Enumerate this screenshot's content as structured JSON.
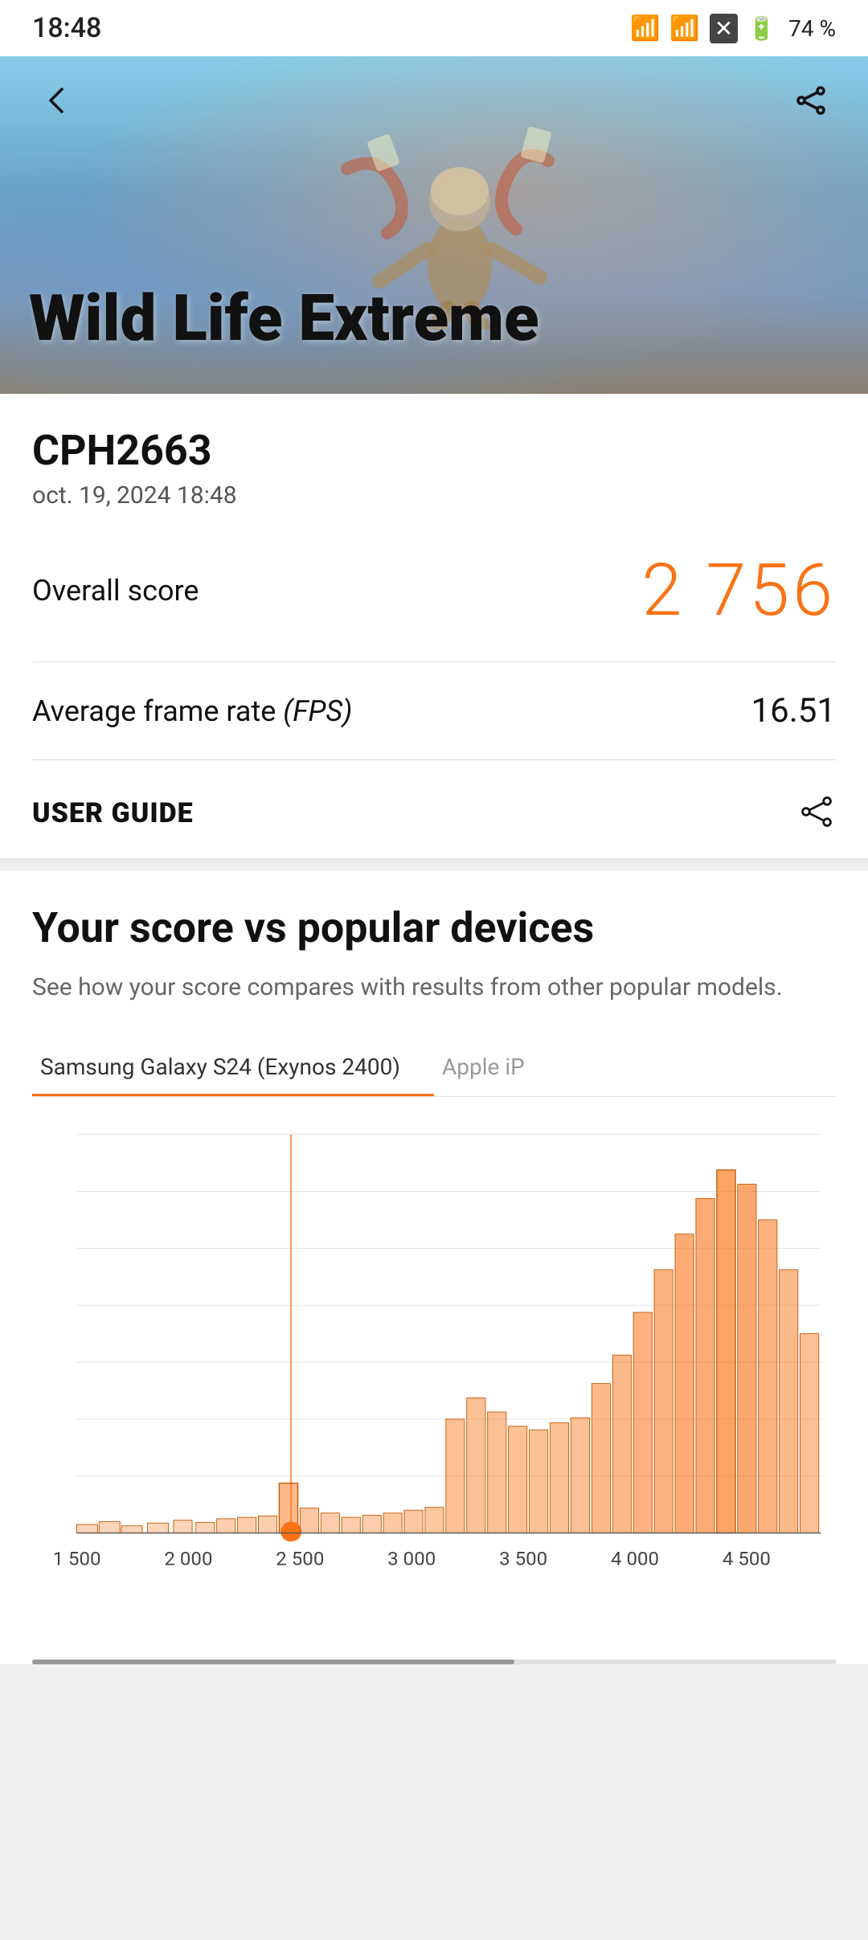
{
  "statusBar": {
    "time": "18:48",
    "battery": "74 %"
  },
  "hero": {
    "title": "Wild Life Extreme",
    "backLabel": "back",
    "shareLabel": "share"
  },
  "result": {
    "deviceName": "CPH2663",
    "date": "oct. 19, 2024 18:48",
    "overallScoreLabel": "Overall score",
    "overallScoreValue": "2 756",
    "fpsLabel": "Average frame rate",
    "fpsUnit": "(FPS)",
    "fpsValue": "16.51",
    "userGuideLabel": "USER GUIDE"
  },
  "comparison": {
    "title": "Your score vs popular devices",
    "subtitle": "See how your score compares with results from other popular models.",
    "tabs": [
      {
        "label": "Samsung Galaxy S24 (Exynos 2400)",
        "active": true
      },
      {
        "label": "Apple iP",
        "active": false
      }
    ],
    "chartXLabels": [
      "1 500",
      "2 000",
      "2 500",
      "3 000",
      "3 500",
      "4 000",
      "4 500"
    ],
    "userScoreMarker": "2 756"
  }
}
